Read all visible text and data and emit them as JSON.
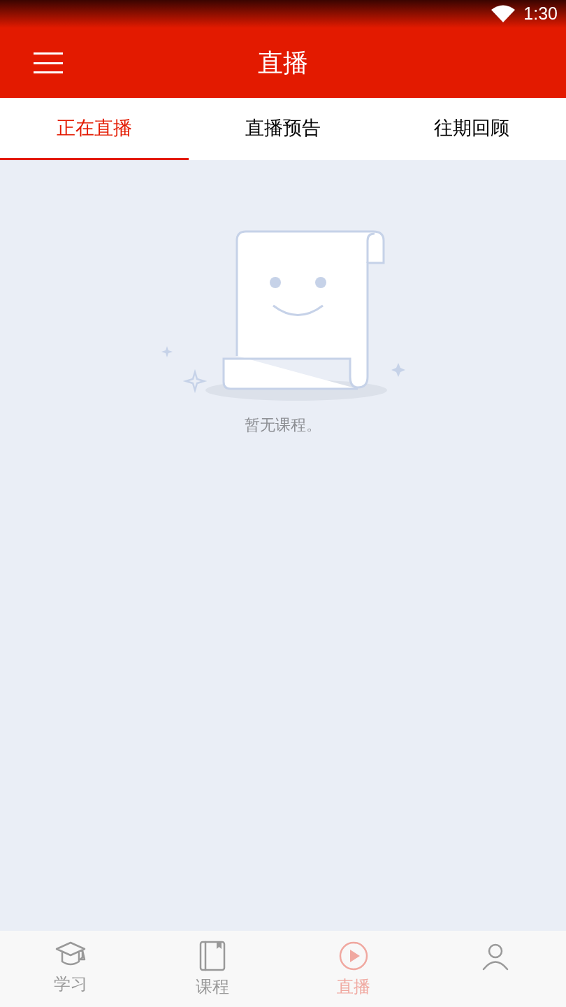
{
  "status_bar": {
    "time": "1:30"
  },
  "header": {
    "title": "直播"
  },
  "tabs": [
    {
      "label": "正在直播",
      "selected": true
    },
    {
      "label": "直播预告",
      "selected": false
    },
    {
      "label": "往期回顾",
      "selected": false
    }
  ],
  "empty_state": {
    "message": "暂无课程。"
  },
  "bottom_nav": [
    {
      "kind": "study",
      "label": "学习",
      "selected": false
    },
    {
      "kind": "course",
      "label": "课程",
      "selected": false
    },
    {
      "kind": "live",
      "label": "直播",
      "selected": true
    },
    {
      "kind": "profile",
      "selected": false
    }
  ]
}
